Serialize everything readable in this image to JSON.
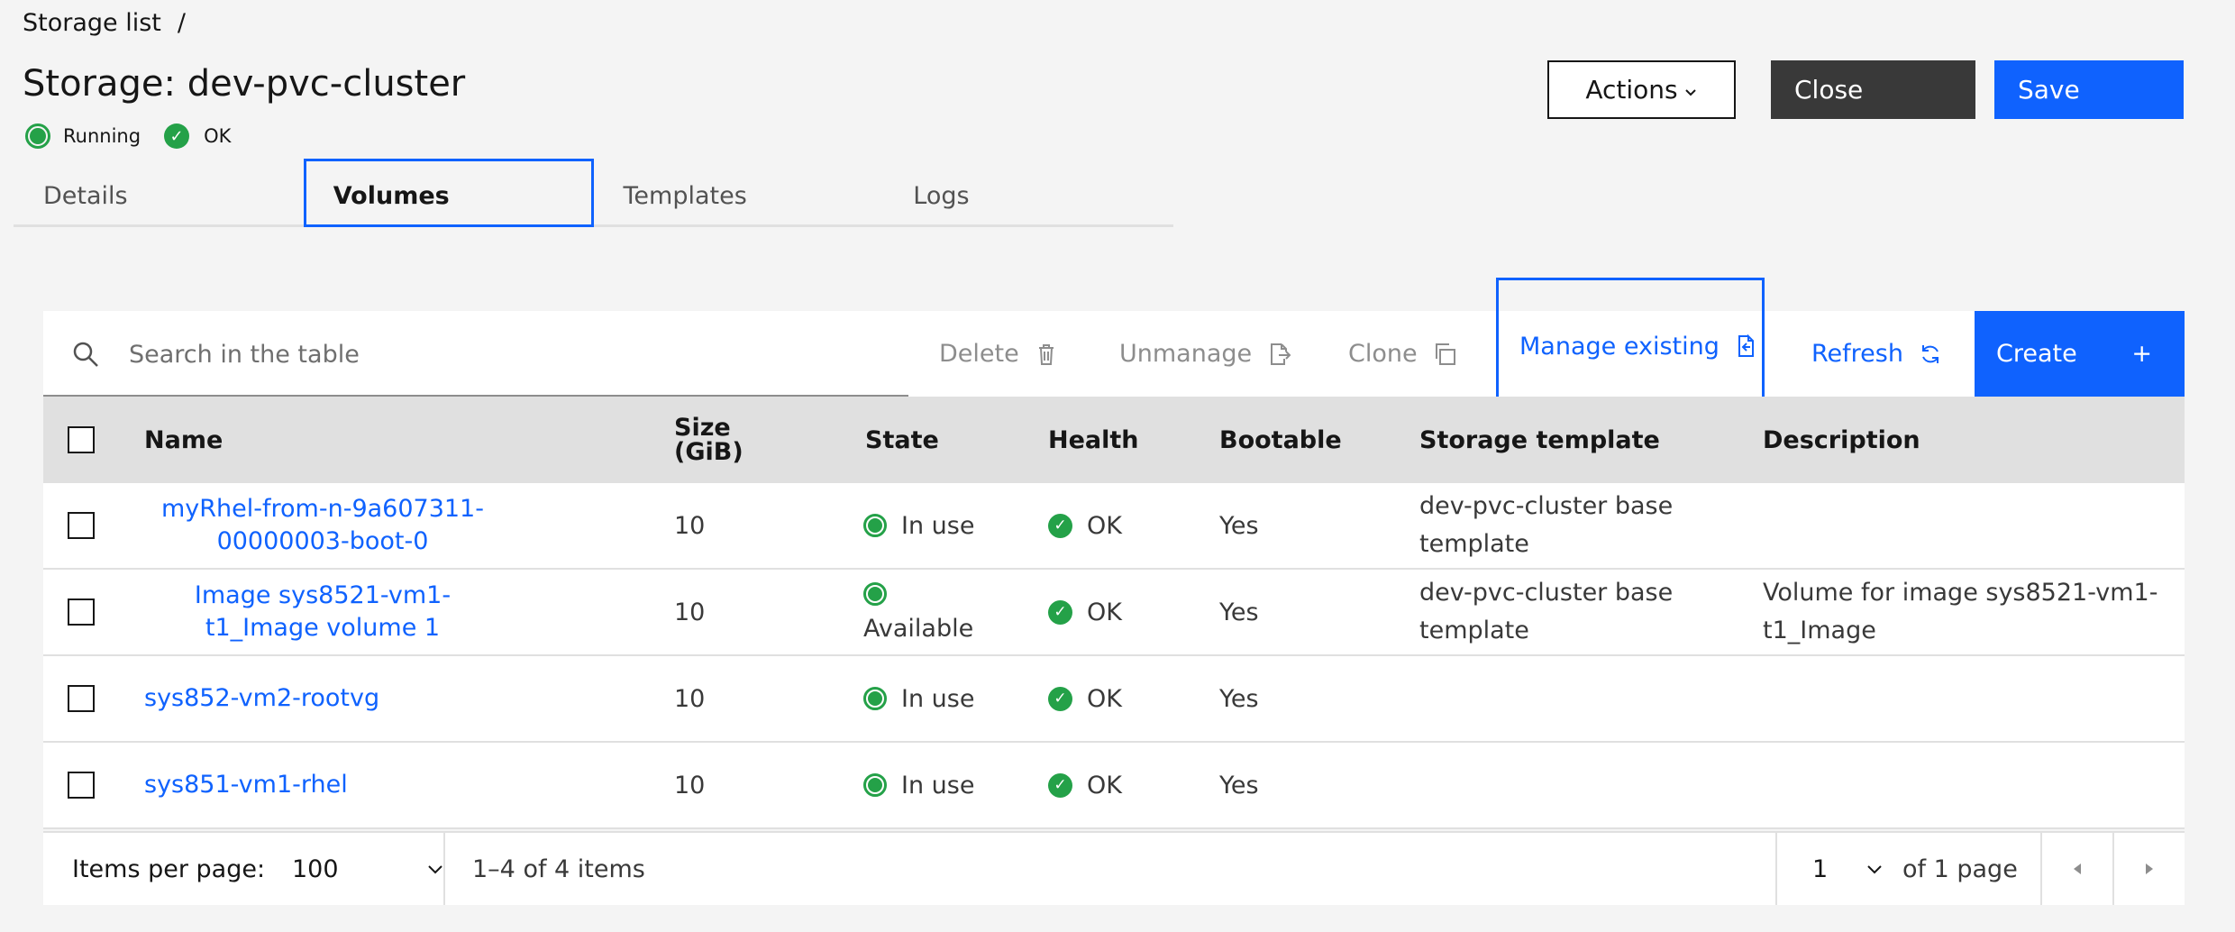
{
  "breadcrumb": {
    "item": "Storage list",
    "separator": "/"
  },
  "page": {
    "title": "Storage: dev-pvc-cluster"
  },
  "status": {
    "running": "Running",
    "ok": "OK"
  },
  "header_buttons": {
    "actions": "Actions",
    "close": "Close",
    "save": "Save"
  },
  "tabs": [
    {
      "label": "Details"
    },
    {
      "label": "Volumes",
      "selected": true
    },
    {
      "label": "Templates"
    },
    {
      "label": "Logs"
    }
  ],
  "toolbar": {
    "search_placeholder": "Search in the table",
    "delete": "Delete",
    "unmanage": "Unmanage",
    "clone": "Clone",
    "manage_existing": "Manage existing",
    "refresh": "Refresh",
    "create": "Create",
    "create_icon": "+"
  },
  "table": {
    "headers": {
      "name": "Name",
      "size_line1": "Size",
      "size_line2": "(GiB)",
      "state": "State",
      "health": "Health",
      "bootable": "Bootable",
      "storage_template": "Storage template",
      "description": "Description"
    },
    "rows": [
      {
        "name": "myRhel-from-n-9a607311-00000003-boot-0",
        "size": "10",
        "state": "In use",
        "health": "OK",
        "bootable": "Yes",
        "template": "dev-pvc-cluster base template",
        "description": ""
      },
      {
        "name": "Image sys8521-vm1-t1_Image volume 1",
        "size": "10",
        "state": "Available",
        "health": "OK",
        "bootable": "Yes",
        "template": "dev-pvc-cluster base template",
        "description": "Volume for image sys8521-vm1-t1_Image"
      },
      {
        "name": "sys852-vm2-rootvg",
        "size": "10",
        "state": "In use",
        "health": "OK",
        "bootable": "Yes",
        "template": "",
        "description": ""
      },
      {
        "name": "sys851-vm1-rhel",
        "size": "10",
        "state": "In use",
        "health": "OK",
        "bootable": "Yes",
        "template": "",
        "description": ""
      }
    ]
  },
  "pagination": {
    "items_per_page_label": "Items per page:",
    "items_per_page": "100",
    "range": "1–4 of 4 items",
    "page": "1",
    "of_pages": "of 1 page"
  },
  "colors": {
    "accent": "#0f62fe",
    "success": "#24a148",
    "dark_button": "#393939"
  }
}
